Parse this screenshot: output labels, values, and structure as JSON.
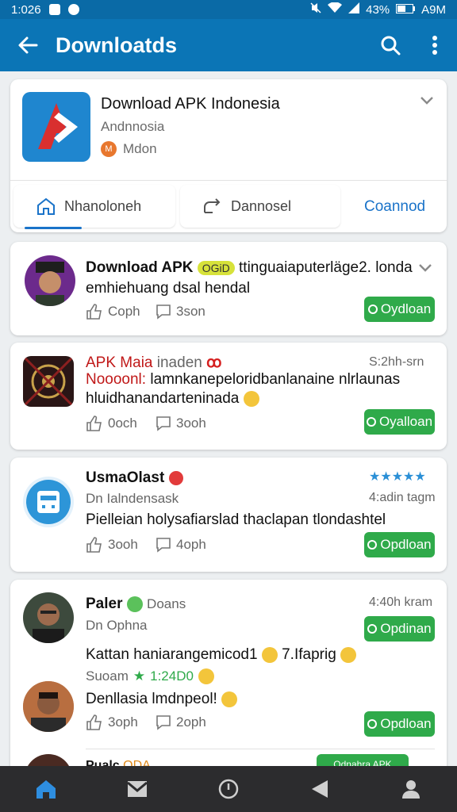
{
  "status_bar": {
    "time": "1:026",
    "battery": "43%",
    "right_time": "A9M"
  },
  "app_bar": {
    "title": "Downloatds"
  },
  "header": {
    "app_title": "Download APK Indonesia",
    "subtitle": "Andnnosia",
    "owner": "Mdon",
    "owner_badge": "M",
    "tabs": [
      {
        "label": "Nhanoloneh"
      },
      {
        "label": "Dannosel"
      }
    ],
    "link": "Coannod"
  },
  "posts": [
    {
      "title": "Download APK",
      "badge": "OGiD",
      "title_rest": "ttinguaiaputerläge2. londa",
      "line2": "emhiehuang dsal hendal",
      "likes": "Coph",
      "comments": "3son",
      "button": "Oydloan"
    },
    {
      "name": "APK Maia",
      "name_extra": "inaden",
      "time": "S:2hh-srn",
      "line1_red": "Noooonl:",
      "line1_rest": "lamnkanepeloridbanlanaine nlrlaunas",
      "line2": "hluidhanandarteninada",
      "likes": "0och",
      "comments": "3ooh",
      "button": "Oyalloan"
    },
    {
      "name": "UsmaOlast",
      "subtitle": "Dn Ialndensask",
      "time": "4:adin tagm",
      "rating": "★★★★★",
      "line1": "Pielleian holysafiarslad thaclapan tlondashtel",
      "likes": "3ooh",
      "comments": "4oph",
      "button": "Opdloan"
    },
    {
      "name": "Paler",
      "name_extra": "Doans",
      "subtitle": "Dn Ophna",
      "time": "4:40h kram",
      "line1": "Kattan haniarangemicod1",
      "line1_tail": "7.Ifaprig",
      "meta_a": "Suoam",
      "meta_b": "1:24D0",
      "line2": "Denllasia lmdnpeol!",
      "likes": "3oph",
      "comments": "2oph",
      "button_top": "Opdinan",
      "button_bottom": "Opdloan"
    }
  ],
  "partial": {
    "name": "Pualc",
    "badge": "ODA",
    "button": "Odnahra APK"
  },
  "bottom_nav": [
    "home-icon",
    "mail-icon",
    "clock-icon",
    "back-icon",
    "profile-icon"
  ],
  "colors": {
    "primary": "#0b75b6",
    "accent": "#1a73c9",
    "green": "#2faa4a",
    "nav": "#2c2c2e"
  }
}
